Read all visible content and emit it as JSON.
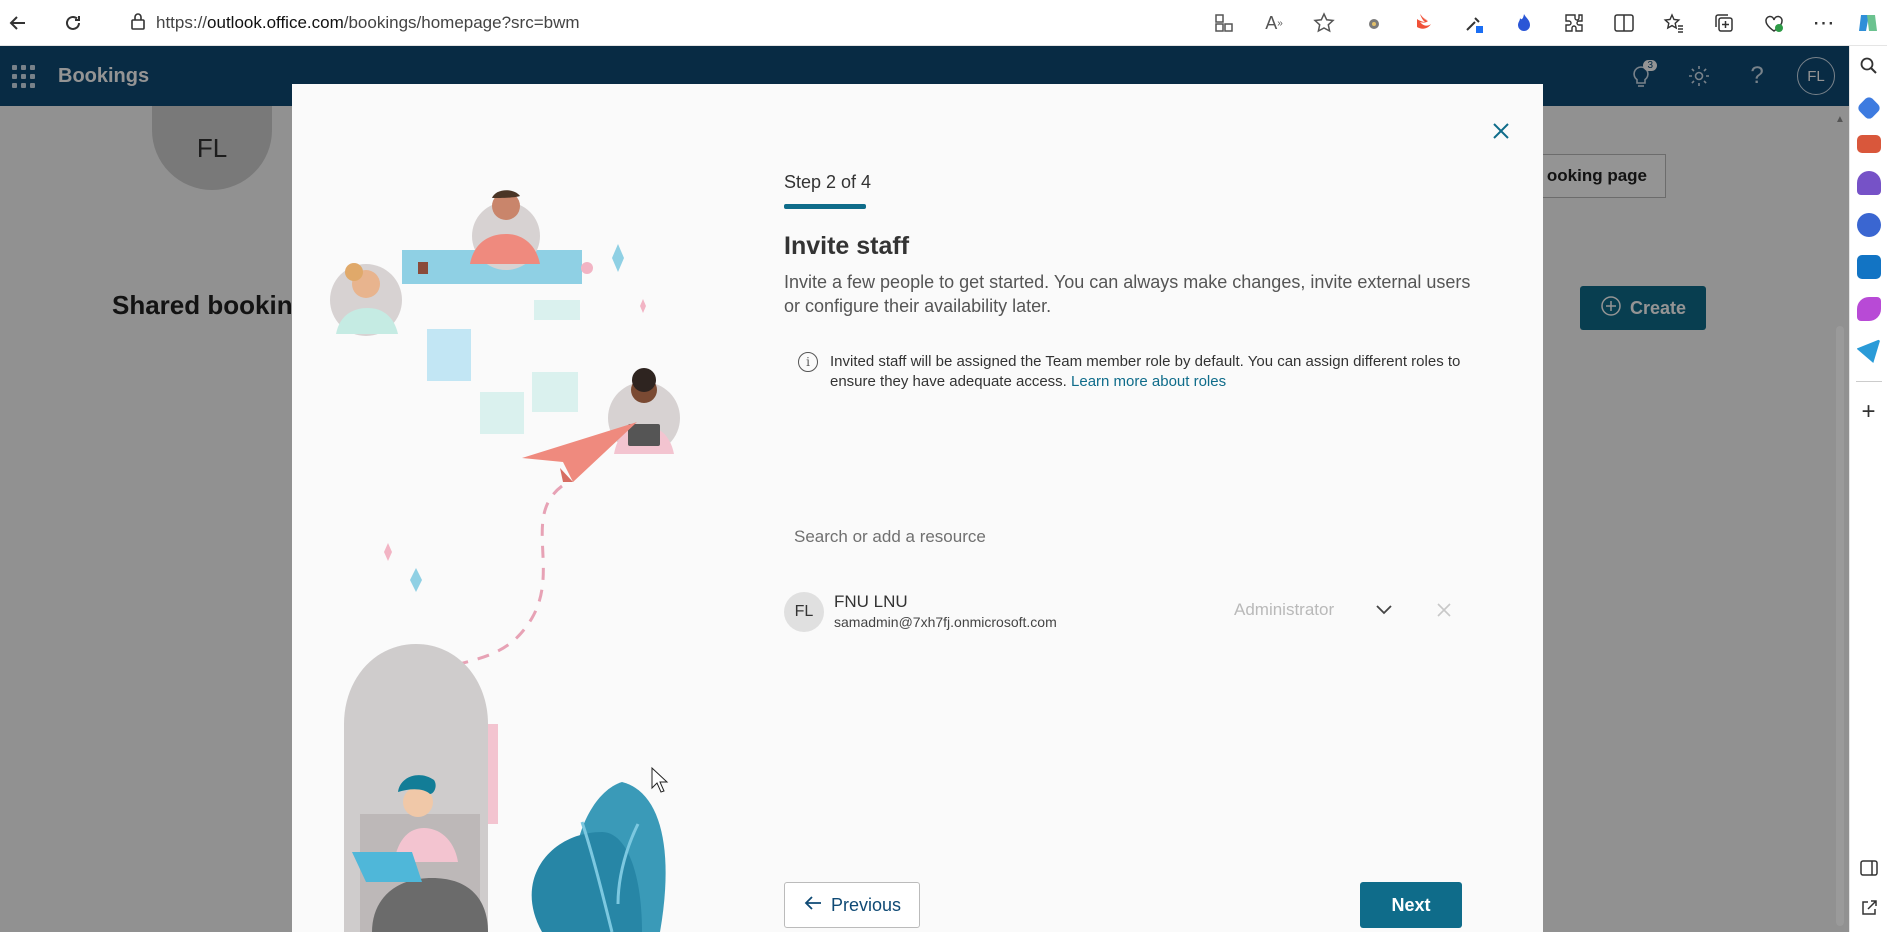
{
  "browser": {
    "url_prefix": "https://",
    "url_host": "outlook.office.com",
    "url_path": "/bookings/homepage?src=bwm"
  },
  "app": {
    "title": "Bookings",
    "notification_count": "3",
    "user_initials": "FL"
  },
  "background": {
    "avatar_initials": "FL",
    "page_title": "Shared booking",
    "booking_page_button": "ooking page",
    "create_button": "Create"
  },
  "wizard": {
    "step_label": "Step 2 of 4",
    "title": "Invite staff",
    "description": "Invite a few people to get started. You can always make changes, invite external users or configure their availability later.",
    "info_text": "Invited staff will be assigned the Team member role by default. You can assign different roles to ensure they have adequate access.",
    "info_link": "Learn more about roles",
    "search_placeholder": "Search or add a resource",
    "staff": [
      {
        "initials": "FL",
        "name": "FNU LNU",
        "email": "samadmin@7xh7fj.onmicrosoft.com",
        "role": "Administrator"
      }
    ],
    "previous_button": "Previous",
    "next_button": "Next"
  },
  "colors": {
    "header_bg": "#0f4a75",
    "accent": "#0f6c8a"
  }
}
